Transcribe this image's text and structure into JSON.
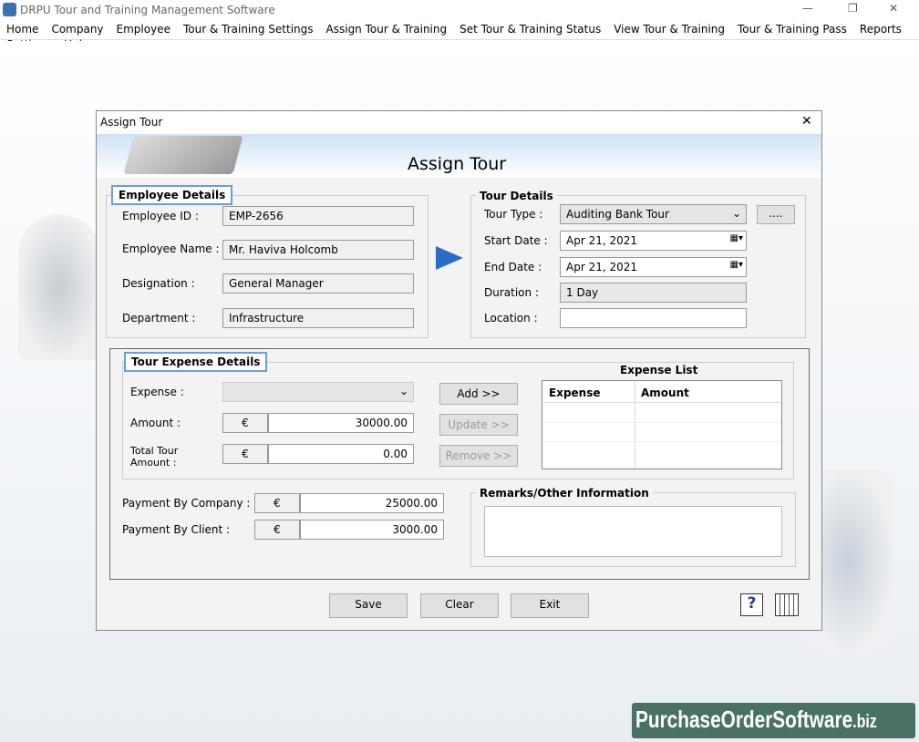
{
  "window": {
    "title": "DRPU Tour and Training Management Software",
    "minimize": "—",
    "maximize": "❐",
    "close": "✕"
  },
  "menu": [
    "Home",
    "Company",
    "Employee",
    "Tour & Training Settings",
    "Assign Tour & Training",
    "Set Tour & Training Status",
    "View Tour & Training",
    "Tour & Training Pass",
    "Reports",
    "Settings",
    "Help"
  ],
  "dialog": {
    "title": "Assign Tour",
    "close": "✕",
    "heading": "Assign Tour",
    "employee": {
      "legend": "Employee Details",
      "id_label": "Employee ID :",
      "id": "EMP-2656",
      "name_label": "Employee Name :",
      "name": "Mr. Haviva Holcomb",
      "designation_label": "Designation :",
      "designation": "General Manager",
      "department_label": "Department :",
      "department": "Infrastructure"
    },
    "tour": {
      "legend": "Tour Details",
      "type_label": "Tour Type :",
      "type": "Auditing Bank Tour",
      "more_button": "....",
      "start_label": "Start Date :",
      "start": "Apr 21, 2021",
      "end_label": "End Date :",
      "end": "Apr 21, 2021",
      "duration_label": "Duration :",
      "duration": "1 Day",
      "location_label": "Location :",
      "location": ""
    },
    "expense": {
      "legend": "Tour Expense Details",
      "expense_label": "Expense :",
      "expense": "",
      "amount_label": "Amount :",
      "currency": "€",
      "amount": "30000.00",
      "total_label_1": "Total Tour",
      "total_label_2": "Amount :",
      "total": "0.00",
      "add": "Add >>",
      "update": "Update >>",
      "remove": "Remove >>",
      "list_title": "Expense List",
      "col_expense": "Expense",
      "col_amount": "Amount"
    },
    "payment": {
      "company_label": "Payment By Company :",
      "company": "25000.00",
      "client_label": "Payment By Client :",
      "client": "3000.00",
      "currency": "€"
    },
    "remarks": {
      "legend": "Remarks/Other Information",
      "value": ""
    },
    "buttons": {
      "save": "Save",
      "clear": "Clear",
      "exit": "Exit",
      "help": "?"
    }
  },
  "watermark": {
    "main": "PurchaseOrderSoftware",
    "tld": ".biz"
  }
}
